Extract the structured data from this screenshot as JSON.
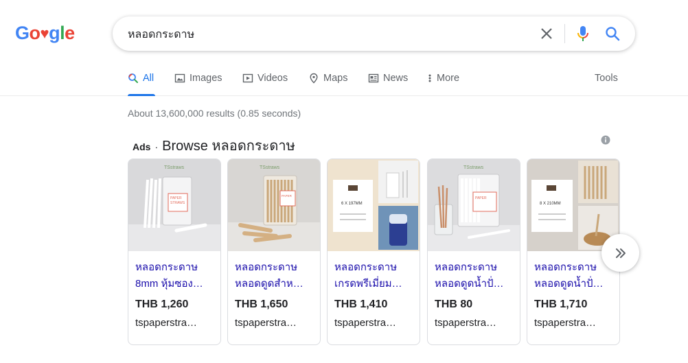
{
  "logo": {
    "c1": "G",
    "c2": "o",
    "c3": "g",
    "c4": "l",
    "c5": "e"
  },
  "search": {
    "query": "หลอดกระดาษ"
  },
  "tabs": [
    {
      "label": "All"
    },
    {
      "label": "Images"
    },
    {
      "label": "Videos"
    },
    {
      "label": "Maps"
    },
    {
      "label": "News"
    },
    {
      "label": "More"
    }
  ],
  "tools_label": "Tools",
  "stats": "About 13,600,000 results (0.85 seconds)",
  "ads": {
    "label": "Ads",
    "separator": "·",
    "title": "Browse หลอดกระดาษ"
  },
  "products": [
    {
      "title1": "หลอดกระดาษ",
      "title2": "8mm หุ้มซอง…",
      "price": "THB 1,260",
      "store": "tspaperstra…"
    },
    {
      "title1": "หลอดกระดาษ",
      "title2": "หลอดดูดสำห…",
      "price": "THB 1,650",
      "store": "tspaperstra…"
    },
    {
      "title1": "หลอดกระดาษ",
      "title2": "เกรดพรีเมี่ยม…",
      "price": "THB 1,410",
      "store": "tspaperstra…"
    },
    {
      "title1": "หลอดกระดาษ",
      "title2": "หลอดดูดน้ำปั่…",
      "price": "THB 80",
      "store": "tspaperstra…"
    },
    {
      "title1": "หลอดกระดาษ",
      "title2": "หลอดดูดน้ำปั่…",
      "price": "THB 1,710",
      "store": "tspaperstra…"
    }
  ],
  "colors": {
    "link": "#1a0dab",
    "accent": "#1a73e8",
    "muted": "#70757a"
  }
}
